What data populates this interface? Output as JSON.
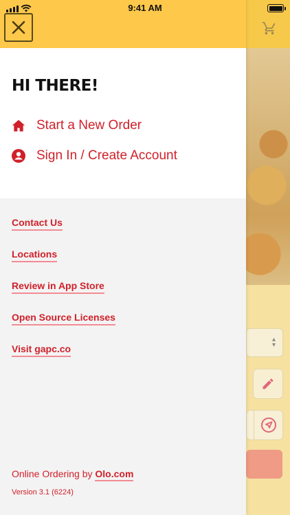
{
  "status_bar": {
    "time": "9:41 AM"
  },
  "drawer": {
    "greeting": "HI THERE!",
    "menu": [
      {
        "label": "Start a New Order",
        "icon": "home-icon"
      },
      {
        "label": "Sign In / Create Account",
        "icon": "user-circle-icon"
      }
    ],
    "links": [
      {
        "label": "Contact Us"
      },
      {
        "label": "Locations"
      },
      {
        "label": "Review in App Store"
      },
      {
        "label": "Open Source Licenses"
      },
      {
        "label": "Visit gapc.co"
      }
    ],
    "footer": {
      "prefix": "Online Ordering by ",
      "brand_link": "Olo.com",
      "version": "Version 3.1 (6224)"
    }
  },
  "colors": {
    "header_yellow": "#fec84a",
    "accent_red": "#d0202a",
    "link_underline": "#f28b93"
  }
}
